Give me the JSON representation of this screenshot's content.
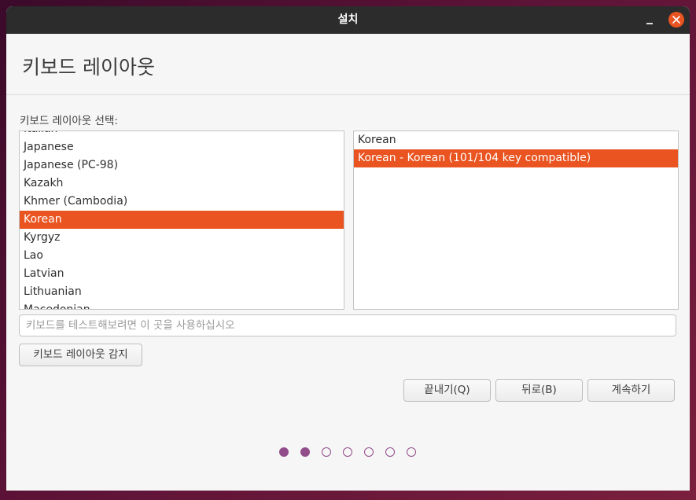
{
  "window": {
    "title": "설치"
  },
  "page": {
    "title": "키보드 레이아웃"
  },
  "layout_prompt": "키보드 레이아웃 선택:",
  "layouts": [
    {
      "label": "Italian",
      "selected": false
    },
    {
      "label": "Japanese",
      "selected": false
    },
    {
      "label": "Japanese (PC-98)",
      "selected": false
    },
    {
      "label": "Kazakh",
      "selected": false
    },
    {
      "label": "Khmer (Cambodia)",
      "selected": false
    },
    {
      "label": "Korean",
      "selected": true
    },
    {
      "label": "Kyrgyz",
      "selected": false
    },
    {
      "label": "Lao",
      "selected": false
    },
    {
      "label": "Latvian",
      "selected": false
    },
    {
      "label": "Lithuanian",
      "selected": false
    },
    {
      "label": "Macedonian",
      "selected": false
    }
  ],
  "variants": [
    {
      "label": "Korean",
      "selected": false
    },
    {
      "label": "Korean - Korean (101/104 key compatible)",
      "selected": true
    }
  ],
  "test_input": {
    "placeholder": "키보드를 테스트해보려면 이 곳을 사용하십시오",
    "value": ""
  },
  "buttons": {
    "detect": "키보드 레이아웃 감지",
    "quit": "끝내기(Q)",
    "back": "뒤로(B)",
    "continue": "계속하기"
  },
  "progress": {
    "total_steps": 7,
    "current_step": 2
  },
  "colors": {
    "accent": "#e95420",
    "progress": "#924d8b",
    "titlebar": "#2c2c2c"
  }
}
